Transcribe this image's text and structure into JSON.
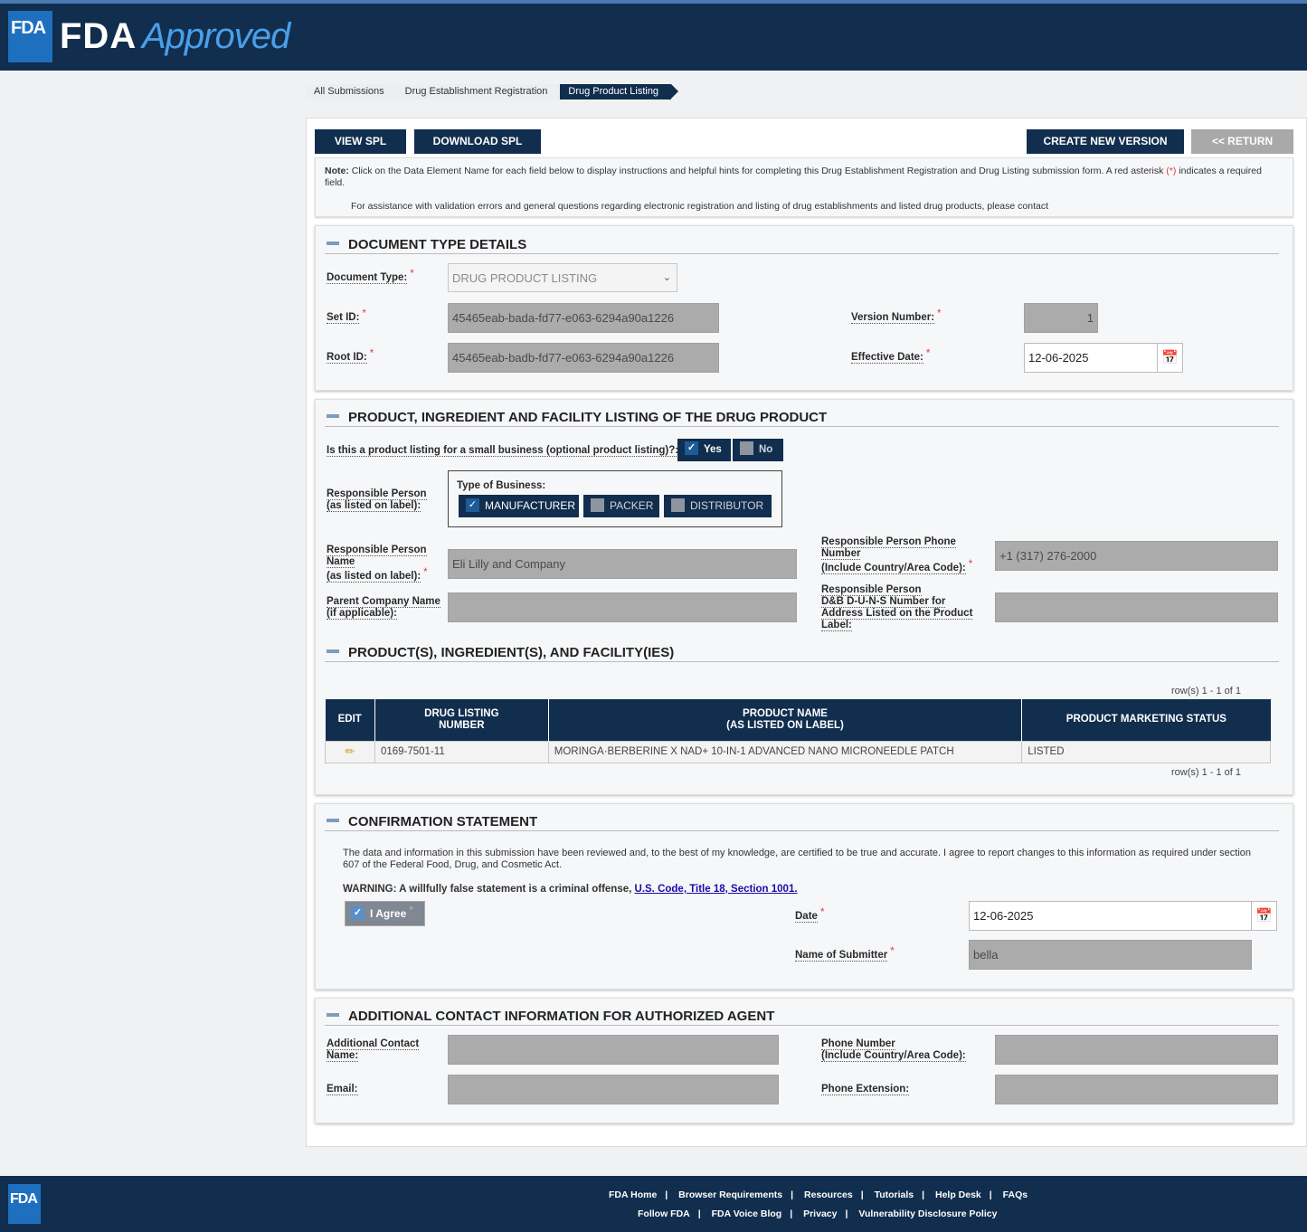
{
  "header": {
    "logo_badge": "FDA",
    "brand_bold": "FDA",
    "brand_italic": "Approved"
  },
  "breadcrumb": [
    "All Submissions",
    "Drug Establishment Registration",
    "Drug Product Listing"
  ],
  "toolbar": {
    "view_spl": "VIEW SPL",
    "download_spl": "DOWNLOAD SPL",
    "create_new_version": "CREATE NEW VERSION",
    "return": "<< RETURN"
  },
  "note": {
    "label": "Note:",
    "text": "Click on the Data Element Name for each field below to display instructions and helpful hints for completing this Drug Establishment Registration and Drug Listing submission form. A red asterisk",
    "asterisk": "(*)",
    "text2": "indicates a required field.",
    "assistance": "For assistance with validation errors and general questions regarding electronic registration and listing of drug establishments and listed drug products, please contact"
  },
  "document_type": {
    "title": "DOCUMENT TYPE DETAILS",
    "doc_type_label": "Document Type:",
    "doc_type_value": "DRUG PRODUCT LISTING",
    "set_id_label": "Set ID:",
    "set_id_value": "45465eab-bada-fd77-e063-6294a90a1226",
    "root_id_label": "Root ID:",
    "root_id_value": "45465eab-badb-fd77-e063-6294a90a1226",
    "version_label": "Version Number:",
    "version_value": "1",
    "effective_date_label": "Effective Date:",
    "effective_date_value": "12-06-2025"
  },
  "product_listing": {
    "title": "PRODUCT, INGREDIENT AND FACILITY LISTING OF THE DRUG PRODUCT",
    "small_business_label": "Is this a product listing for a small business (optional product listing)?:",
    "yes": "Yes",
    "no": "No",
    "resp_person_label_1": "Responsible Person",
    "resp_person_label_2": "(as listed on label):",
    "type_of_business_label": "Type of Business:",
    "business_types": [
      "MANUFACTURER",
      "PACKER",
      "DISTRIBUTOR"
    ],
    "resp_name_label_1": "Responsible Person",
    "resp_name_label_2": "Name",
    "resp_name_label_3": "(as listed on label):",
    "resp_name_value": "Eli Lilly and Company",
    "phone_label_1": "Responsible Person Phone",
    "phone_label_2": "Number",
    "phone_label_3": "(Include Country/Area Code):",
    "phone_value": "+1 (317) 276-2000",
    "parent_label_1": "Parent Company Name",
    "parent_label_2": "(if applicable):",
    "parent_value": "",
    "duns_label_1": "Responsible Person",
    "duns_label_2": "D&B D-U-N-S Number for",
    "duns_label_3": "Address Listed on the Product",
    "duns_label_4": "Label:",
    "duns_value": ""
  },
  "products_table": {
    "title": "PRODUCT(S), INGREDIENT(S), AND FACILITY(IES)",
    "rows_info": "row(s) 1 - 1 of 1",
    "headers": {
      "edit": "EDIT",
      "listing_1": "DRUG LISTING",
      "listing_2": "NUMBER",
      "name_1": "PRODUCT NAME",
      "name_2": "(AS LISTED ON LABEL)",
      "status": "PRODUCT MARKETING STATUS"
    },
    "rows": [
      {
        "edit_icon": "pencil-icon",
        "listing_number": "0169-7501-11",
        "product_name": "MORINGA·BERBERINE X NAD+ 10-IN-1 ADVANCED NANO MICRONEEDLE PATCH",
        "status": "LISTED"
      }
    ]
  },
  "confirmation": {
    "title": "CONFIRMATION STATEMENT",
    "statement": "The data and information in this submission have been reviewed and, to the best of my knowledge, are certified to be true and accurate. I agree to report changes to this information as required under section 607 of the Federal Food, Drug, and Cosmetic Act.",
    "warning": "WARNING: A willfully false statement is a criminal offense,",
    "warning_link": "U.S. Code, Title 18, Section 1001.",
    "agree_label": "I Agree",
    "date_label": "Date",
    "date_value": "12-06-2025",
    "submitter_label": "Name of Submitter",
    "submitter_value": "bella"
  },
  "agent": {
    "title": "ADDITIONAL CONTACT INFORMATION FOR AUTHORIZED AGENT",
    "contact_name_label_1": "Additional Contact",
    "contact_name_label_2": "Name:",
    "phone_label_1": "Phone Number",
    "phone_label_2": "(Include Country/Area Code):",
    "email_label": "Email:",
    "extension_label": "Phone Extension:"
  },
  "footer": {
    "logo_badge": "FDA",
    "row1": [
      "FDA Home",
      "Browser Requirements",
      "Resources",
      "Tutorials",
      "Help Desk",
      "FAQs"
    ],
    "row2": [
      "Follow FDA",
      "FDA Voice Blog",
      "Privacy",
      "Vulnerability Disclosure Policy"
    ],
    "separator": "|"
  },
  "colors": {
    "navy": "#112e4e",
    "brand_blue": "#1f6fbf",
    "required": "#e04040",
    "link": "#1a0dab"
  }
}
